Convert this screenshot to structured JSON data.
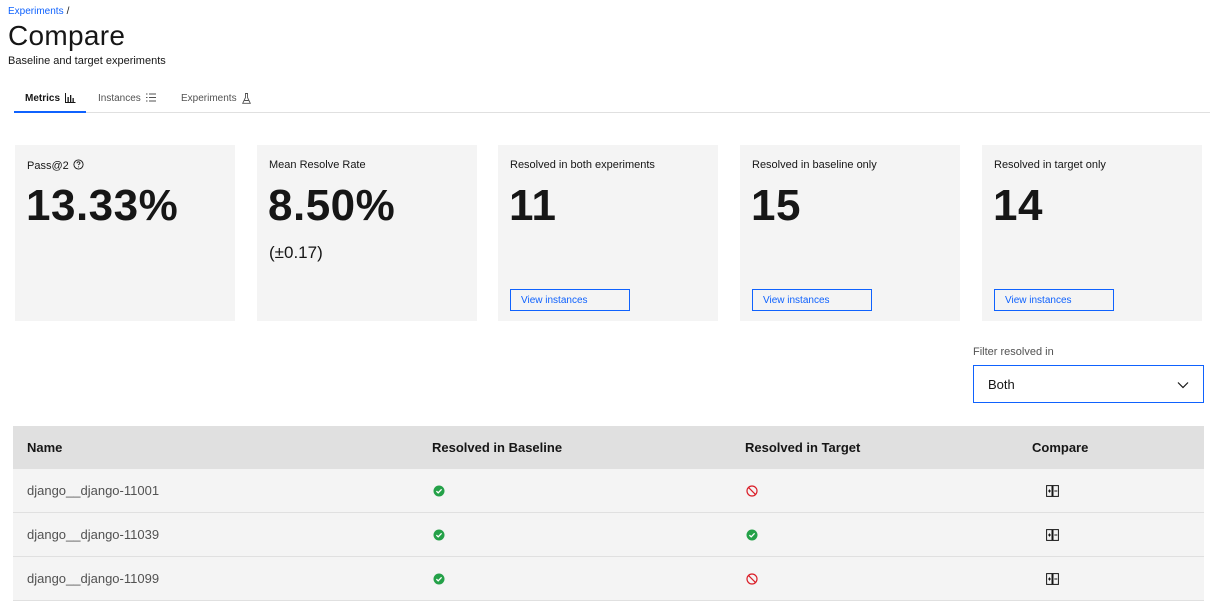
{
  "breadcrumb": {
    "link": "Experiments",
    "separator": "/"
  },
  "page": {
    "title": "Compare",
    "subtitle": "Baseline and target experiments"
  },
  "tabs": [
    {
      "label": "Metrics",
      "icon": "bar-chart-icon",
      "active": true
    },
    {
      "label": "Instances",
      "icon": "list-icon",
      "active": false
    },
    {
      "label": "Experiments",
      "icon": "flask-icon",
      "active": false
    }
  ],
  "cards": [
    {
      "label": "Pass@2",
      "value": "13.33%",
      "has_help": true
    },
    {
      "label": "Mean Resolve Rate",
      "value": "8.50%",
      "sub": "(±0.17)"
    },
    {
      "label": "Resolved in both experiments",
      "value": "11",
      "button": "View instances"
    },
    {
      "label": "Resolved in baseline only",
      "value": "15",
      "button": "View instances"
    },
    {
      "label": "Resolved in target only",
      "value": "14",
      "button": "View instances"
    }
  ],
  "filter": {
    "label": "Filter resolved in",
    "value": "Both"
  },
  "table": {
    "headers": {
      "name": "Name",
      "baseline": "Resolved in Baseline",
      "target": "Resolved in Target",
      "compare": "Compare"
    },
    "rows": [
      {
        "name": "django__django-11001",
        "baseline": true,
        "target": false
      },
      {
        "name": "django__django-11039",
        "baseline": true,
        "target": true
      },
      {
        "name": "django__django-11099",
        "baseline": true,
        "target": false
      }
    ]
  },
  "colors": {
    "accent": "#0f62fe",
    "success": "#24a148",
    "error": "#da1e28",
    "card_bg": "#f4f4f4",
    "header_bg": "#e0e0e0"
  }
}
